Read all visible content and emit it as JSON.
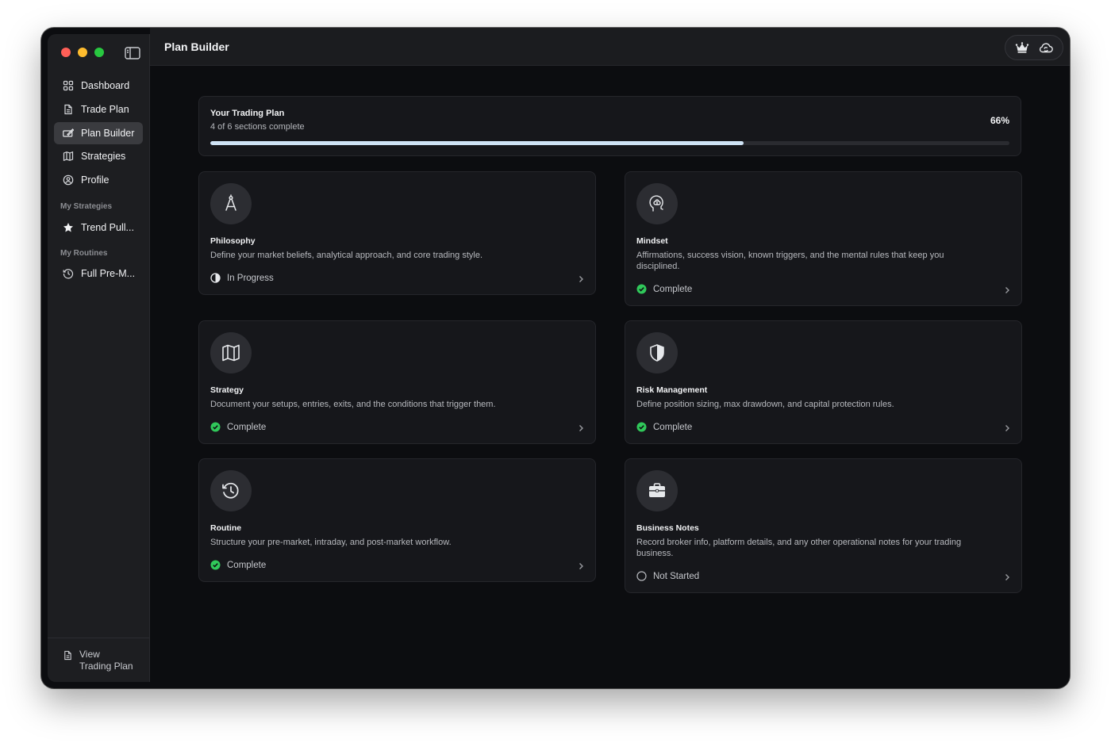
{
  "app": {
    "title": "Plan Builder"
  },
  "sidebar": {
    "items": [
      {
        "label": "Dashboard",
        "icon": "grid-icon",
        "active": false
      },
      {
        "label": "Trade Plan",
        "icon": "document-icon",
        "active": false
      },
      {
        "label": "Plan Builder",
        "icon": "edit-icon",
        "active": true
      },
      {
        "label": "Strategies",
        "icon": "map-icon",
        "active": false
      },
      {
        "label": "Profile",
        "icon": "person-circle-icon",
        "active": false
      }
    ],
    "strategies_label": "My Strategies",
    "strategies": [
      {
        "label": "Trend Pull...",
        "icon": "star-icon"
      }
    ],
    "routines_label": "My Routines",
    "routines": [
      {
        "label": "Full Pre-M...",
        "icon": "history-icon"
      }
    ],
    "footer": {
      "line1": "View",
      "line2": "Trading Plan",
      "icon": "document-icon"
    }
  },
  "topbar": {
    "icons": [
      "crown-icon",
      "cloud-sync-icon"
    ]
  },
  "progress": {
    "title": "Your Trading Plan",
    "subtitle": "4 of 6 sections complete",
    "percent_label": "66%",
    "fraction": 0.667
  },
  "cards": [
    {
      "title": "Philosophy",
      "desc": "Define your market beliefs, analytical approach, and core trading style.",
      "status": "In Progress",
      "status_icon": "half-circle-icon",
      "icon": "compass-icon"
    },
    {
      "title": "Mindset",
      "desc": "Affirmations, success vision, known triggers, and the mental rules that keep you disciplined.",
      "status": "Complete",
      "status_icon": "check-circle-icon",
      "icon": "brain-head-icon"
    },
    {
      "title": "Strategy",
      "desc": "Document your setups, entries, exits, and the conditions that trigger them.",
      "status": "Complete",
      "status_icon": "check-circle-icon",
      "icon": "map-icon"
    },
    {
      "title": "Risk Management",
      "desc": "Define position sizing, max drawdown, and capital protection rules.",
      "status": "Complete",
      "status_icon": "check-circle-icon",
      "icon": "shield-icon"
    },
    {
      "title": "Routine",
      "desc": "Structure your pre-market, intraday, and post-market workflow.",
      "status": "Complete",
      "status_icon": "check-circle-icon",
      "icon": "history-icon"
    },
    {
      "title": "Business Notes",
      "desc": "Record broker info, platform details, and any other operational notes for your trading business.",
      "status": "Not Started",
      "status_icon": "empty-circle-icon",
      "icon": "briefcase-icon"
    }
  ],
  "colors": {
    "accent_progress": "#cfe3f5",
    "complete_green": "#30c85a",
    "window_bg": "#0c0d10",
    "card_bg": "#16171b"
  }
}
